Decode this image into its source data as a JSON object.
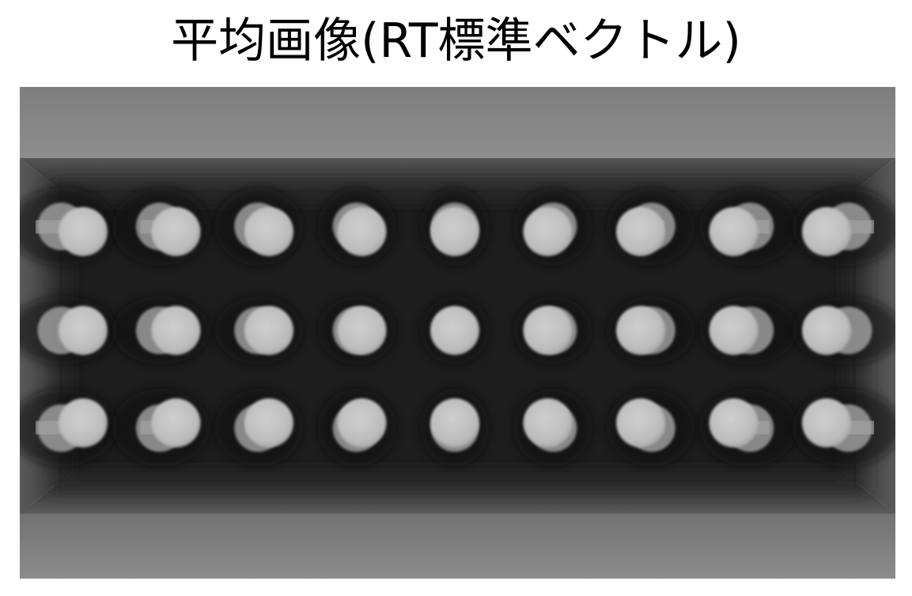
{
  "title": "平均画像(RT標準ベクトル)",
  "image": {
    "description_colors": {
      "outer_frame": "#8a8a8a",
      "inner_wall": "#4a4a4a",
      "cavity": "#1c1c1c",
      "pin": "#c4c4c4"
    },
    "grid": {
      "rows": 3,
      "columns": 9
    }
  }
}
